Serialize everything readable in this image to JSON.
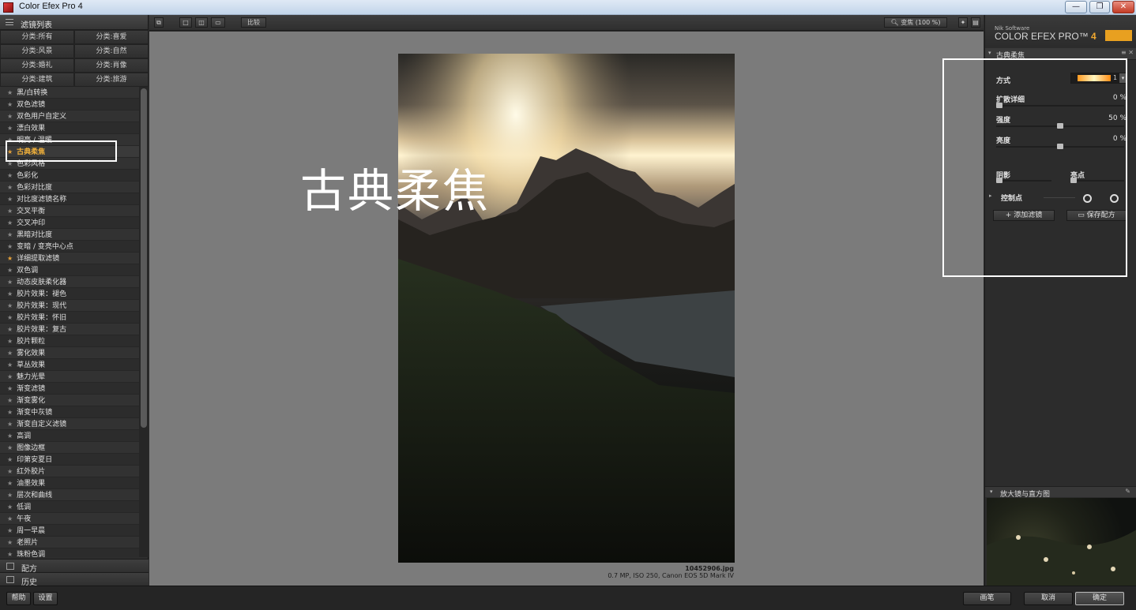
{
  "window": {
    "title": "Color Efex Pro 4",
    "buttons": {
      "minimize": "—",
      "restore": "❐",
      "close": "✕"
    }
  },
  "left_panel": {
    "header": "滤镜列表",
    "categories": [
      "分类:所有",
      "分类:喜爱",
      "分类:风景",
      "分类:自然",
      "分类:婚礼",
      "分类:肖像",
      "分类:建筑",
      "分类:旅游"
    ],
    "filters": [
      {
        "label": "黑/白转换",
        "fav": false
      },
      {
        "label": "双色滤镜",
        "fav": false
      },
      {
        "label": "双色用户自定义",
        "fav": false
      },
      {
        "label": "漂白效果",
        "fav": false
      },
      {
        "label": "明亮 / 温暖",
        "fav": false
      },
      {
        "label": "古典柔焦",
        "fav": true,
        "selected": true
      },
      {
        "label": "色彩风格",
        "fav": false
      },
      {
        "label": "色彩化",
        "fav": false
      },
      {
        "label": "色彩对比度",
        "fav": false
      },
      {
        "label": "对比度滤镜名称",
        "fav": false
      },
      {
        "label": "交叉平衡",
        "fav": false
      },
      {
        "label": "交叉冲印",
        "fav": false
      },
      {
        "label": "黑暗对比度",
        "fav": false
      },
      {
        "label": "变暗 / 变亮中心点",
        "fav": false
      },
      {
        "label": "详细提取滤镜",
        "fav": true
      },
      {
        "label": "双色调",
        "fav": false
      },
      {
        "label": "动态皮肤柔化器",
        "fav": false
      },
      {
        "label": "胶片效果：褪色",
        "fav": false
      },
      {
        "label": "胶片效果：现代",
        "fav": false
      },
      {
        "label": "胶片效果：怀旧",
        "fav": false
      },
      {
        "label": "胶片效果：复古",
        "fav": false
      },
      {
        "label": "胶片颗粒",
        "fav": false
      },
      {
        "label": "雾化效果",
        "fav": false
      },
      {
        "label": "草丛效果",
        "fav": false
      },
      {
        "label": "魅力光晕",
        "fav": false
      },
      {
        "label": "渐变滤镜",
        "fav": false
      },
      {
        "label": "渐变雾化",
        "fav": false
      },
      {
        "label": "渐变中灰镜",
        "fav": false
      },
      {
        "label": "渐变自定义滤镜",
        "fav": false
      },
      {
        "label": "高调",
        "fav": false
      },
      {
        "label": "图像边框",
        "fav": false
      },
      {
        "label": "印第安夏日",
        "fav": false
      },
      {
        "label": "红外胶片",
        "fav": false
      },
      {
        "label": "油墨效果",
        "fav": false
      },
      {
        "label": "层次和曲线",
        "fav": false
      },
      {
        "label": "低调",
        "fav": false
      },
      {
        "label": "午夜",
        "fav": false
      },
      {
        "label": "周一早晨",
        "fav": false
      },
      {
        "label": "老照片",
        "fav": false
      },
      {
        "label": "珠粉色调",
        "fav": false
      }
    ],
    "recipes_label": "配方",
    "history_label": "历史"
  },
  "toolbar": {
    "compare_label": "比较",
    "zoom_label": "变焦 (100 %)"
  },
  "photo": {
    "filename": "10452906.jpg",
    "info": "0.7 MP, ISO 250, Canon EOS 5D Mark IV"
  },
  "annotation": {
    "text": "古典柔焦"
  },
  "right_panel": {
    "vendor": "Nik Software",
    "product": "COLOR EFEX PRO",
    "product_tm": "™",
    "product_num": "4",
    "filter_name": "古典柔焦",
    "controls": {
      "method_label": "方式",
      "method_count": "1",
      "diffuse_label": "扩散详细",
      "diffuse_value": "0 %",
      "diffuse_level": 0,
      "strength_label": "强度",
      "strength_value": "50 %",
      "strength_level": 50,
      "brightness_label": "亮度",
      "brightness_value": "0 %",
      "brightness_level": 50,
      "shadows_label": "阴影",
      "highlights_label": "亮点",
      "control_points_label": "控制点"
    },
    "add_filter_label": "添加滤镜",
    "save_recipe_label": "保存配方",
    "loupe_label": "放大镜与直方图"
  },
  "footer": {
    "help": "帮助",
    "settings": "设置",
    "brush": "画笔",
    "cancel": "取消",
    "ok": "确定"
  }
}
